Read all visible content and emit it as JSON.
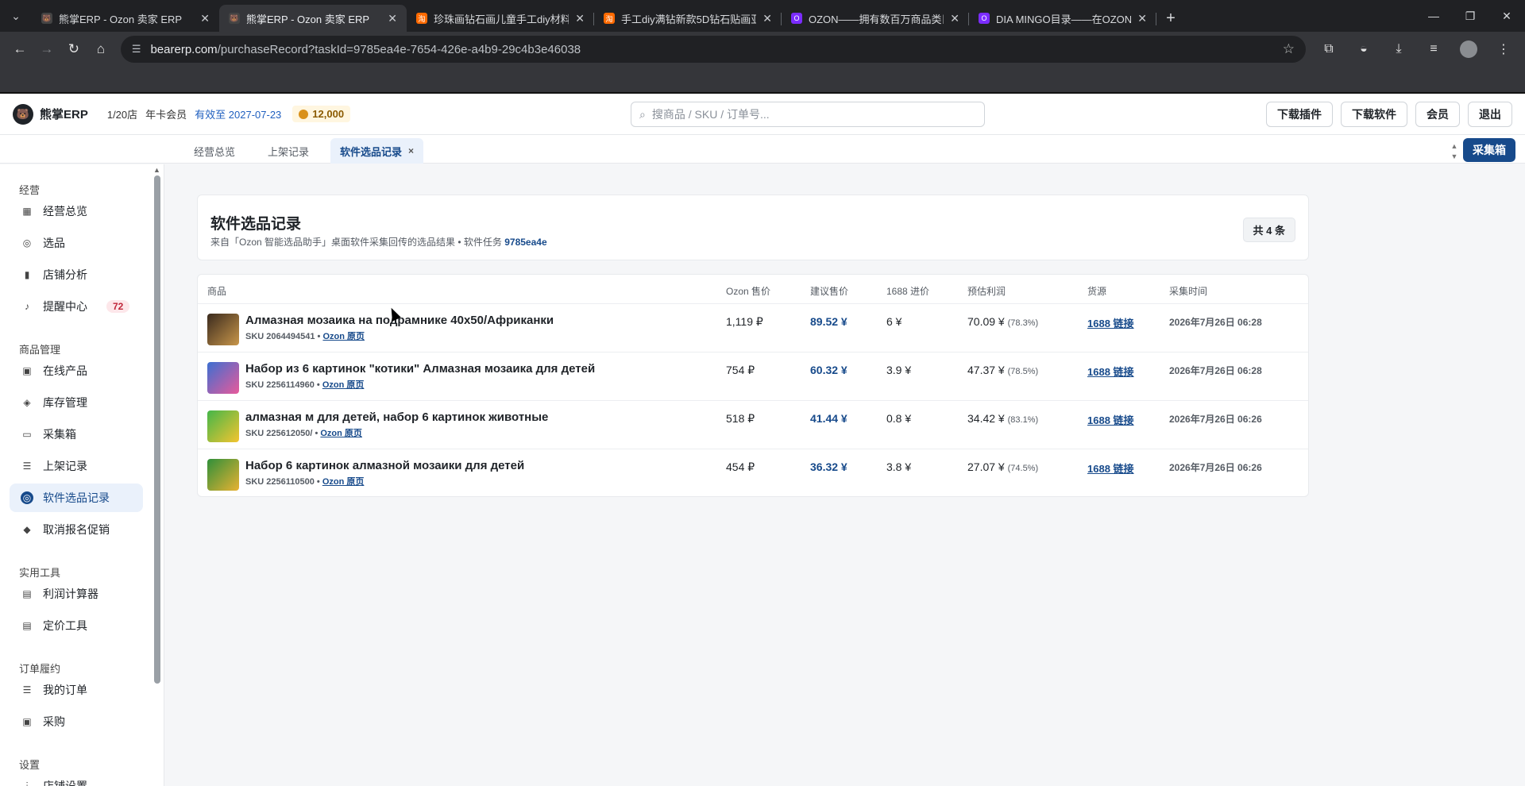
{
  "browser": {
    "tabs": [
      {
        "title": "熊掌ERP - Ozon 卖家 ERP",
        "favicon_color": "#444444",
        "favicon": "🐻"
      },
      {
        "title": "熊掌ERP - Ozon 卖家 ERP",
        "favicon_color": "#444444",
        "favicon": "🐻"
      },
      {
        "title": "珍珠画钻石画儿童手工diy材料包",
        "favicon_color": "#ff6a00",
        "favicon": "淘"
      },
      {
        "title": "手工diy满钻新款5D钻石贴画亚",
        "favicon_color": "#ff6a00",
        "favicon": "淘"
      },
      {
        "title": "OZON——拥有数百万商品类目",
        "favicon_color": "#7b2cff",
        "favicon": "O"
      },
      {
        "title": "DIA MINGO目录——在OZON",
        "favicon_color": "#7b2cff",
        "favicon": "O"
      }
    ],
    "active_tab": 1,
    "url_host": "bearerp.com",
    "url_path": "/purchaseRecord?taskId=9785ea4e-7654-426e-a4b9-29c4b3e46038"
  },
  "header": {
    "brand": "熊掌ERP",
    "stores": "1/20店",
    "membership": "年卡会员",
    "expiry": "有效至 2027-07-23",
    "coins": "12,000",
    "search_placeholder": "搜商品 / SKU / 订单号...",
    "buttons": [
      "下载插件",
      "下载软件",
      "会员",
      "退出"
    ]
  },
  "page_tabs": [
    {
      "label": "经营总览"
    },
    {
      "label": "上架记录"
    },
    {
      "label": "软件选品记录",
      "active": true
    }
  ],
  "collect_button": "采集箱",
  "sidebar": {
    "groups": [
      {
        "label": "经营",
        "items": [
          {
            "label": "经营总览",
            "icon": "grid-icon"
          },
          {
            "label": "选品",
            "icon": "target-icon"
          },
          {
            "label": "店铺分析",
            "icon": "bar-chart-icon"
          },
          {
            "label": "提醒中心",
            "icon": "bell-icon",
            "badge": "72"
          }
        ]
      },
      {
        "label": "商品管理",
        "items": [
          {
            "label": "在线产品",
            "icon": "box-icon"
          },
          {
            "label": "库存管理",
            "icon": "layers-icon"
          },
          {
            "label": "采集箱",
            "icon": "inbox-icon"
          },
          {
            "label": "上架记录",
            "icon": "list-icon"
          },
          {
            "label": "软件选品记录",
            "icon": "target-icon",
            "active": true
          },
          {
            "label": "取消报名促销",
            "icon": "tag-icon"
          }
        ]
      },
      {
        "label": "实用工具",
        "items": [
          {
            "label": "利润计算器",
            "icon": "calculator-icon"
          },
          {
            "label": "定价工具",
            "icon": "calculator-icon"
          }
        ]
      },
      {
        "label": "订单履约",
        "items": [
          {
            "label": "我的订单",
            "icon": "list-icon"
          },
          {
            "label": "采购",
            "icon": "box-icon"
          }
        ]
      },
      {
        "label": "设置",
        "items": [
          {
            "label": "店铺设置",
            "icon": "sliders-icon"
          }
        ]
      }
    ]
  },
  "summary": {
    "title": "软件选品记录",
    "subtitle_prefix": "来自「Ozon 智能选品助手」桌面软件采集回传的选品结果 • 软件任务",
    "task_id": "9785ea4e",
    "count": "共 4 条"
  },
  "table": {
    "columns": [
      "商品",
      "Ozon 售价",
      "建议售价",
      "1688 进价",
      "预估利润",
      "货源",
      "采集时间"
    ],
    "rows": [
      {
        "name": "Алмазная мозаика на подрамнике 40х50/Африканки",
        "sku": "SKU 2064494541",
        "shop_link": "Ozon 原页",
        "ozon_price": "1,119 ₽",
        "suggested": "89.52 ¥",
        "cost": "6 ¥",
        "profit": "70.09 ¥",
        "margin": "(78.3%)",
        "source": "1688 链接",
        "time": "2026年7月26日 06:28",
        "thumb_colors": [
          "#3a2a1e",
          "#c8964a"
        ]
      },
      {
        "name": "Набор из 6 картинок \"котики\" Алмазная мозаика для детей",
        "sku": "SKU 2256114960",
        "shop_link": "Ozon 原页",
        "ozon_price": "754 ₽",
        "suggested": "60.32 ¥",
        "cost": "3.9 ¥",
        "profit": "47.37 ¥",
        "margin": "(78.5%)",
        "source": "1688 链接",
        "time": "2026年7月26日 06:28",
        "thumb_colors": [
          "#3c6fd1",
          "#e85a9b"
        ]
      },
      {
        "name": "алмазная м     для детей, набор 6 картинок животные",
        "sku": "SKU 225612050/",
        "shop_link": "Ozon 原页",
        "ozon_price": "518 ₽",
        "suggested": "41.44 ¥",
        "cost": "0.8 ¥",
        "profit": "34.42 ¥",
        "margin": "(83.1%)",
        "source": "1688 链接",
        "time": "2026年7月26日 06:26",
        "thumb_colors": [
          "#44b649",
          "#f4c430"
        ]
      },
      {
        "name": "Набор 6 картинок алмазной мозаики для детей",
        "sku": "SKU 2256110500",
        "shop_link": "Ozon 原页",
        "ozon_price": "454 ₽",
        "suggested": "36.32 ¥",
        "cost": "3.8 ¥",
        "profit": "27.07 ¥",
        "margin": "(74.5%)",
        "source": "1688 链接",
        "time": "2026年7月26日 06:26",
        "thumb_colors": [
          "#2f8f3a",
          "#e8b232"
        ]
      }
    ]
  },
  "colors": {
    "accent": "#174a8b",
    "badge_red": "#c0263a"
  }
}
